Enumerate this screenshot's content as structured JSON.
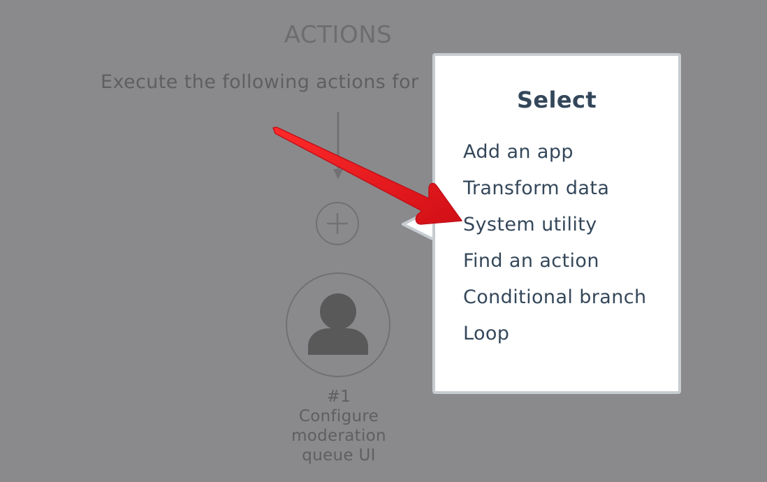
{
  "canvas": {
    "title": "ACTIONS",
    "subtitle": "Execute the following actions for"
  },
  "step": {
    "number": "#1",
    "name_lines": [
      "Configure",
      "moderation",
      "queue UI"
    ]
  },
  "popover": {
    "title": "Select",
    "items": [
      {
        "label": "Add an app"
      },
      {
        "label": "Transform data"
      },
      {
        "label": "System utility"
      },
      {
        "label": "Find an action"
      },
      {
        "label": "Conditional branch"
      },
      {
        "label": "Loop"
      }
    ]
  },
  "colors": {
    "overlay_background": "#8a8a8c",
    "popover_background": "#ffffff",
    "menu_text": "#34475a",
    "annotation_arrow": "#e8121a"
  },
  "icons": {
    "add_step": "plus-icon",
    "avatar": "user-icon",
    "connector": "arrow-down-icon",
    "annotation": "red-arrow-annotation"
  }
}
